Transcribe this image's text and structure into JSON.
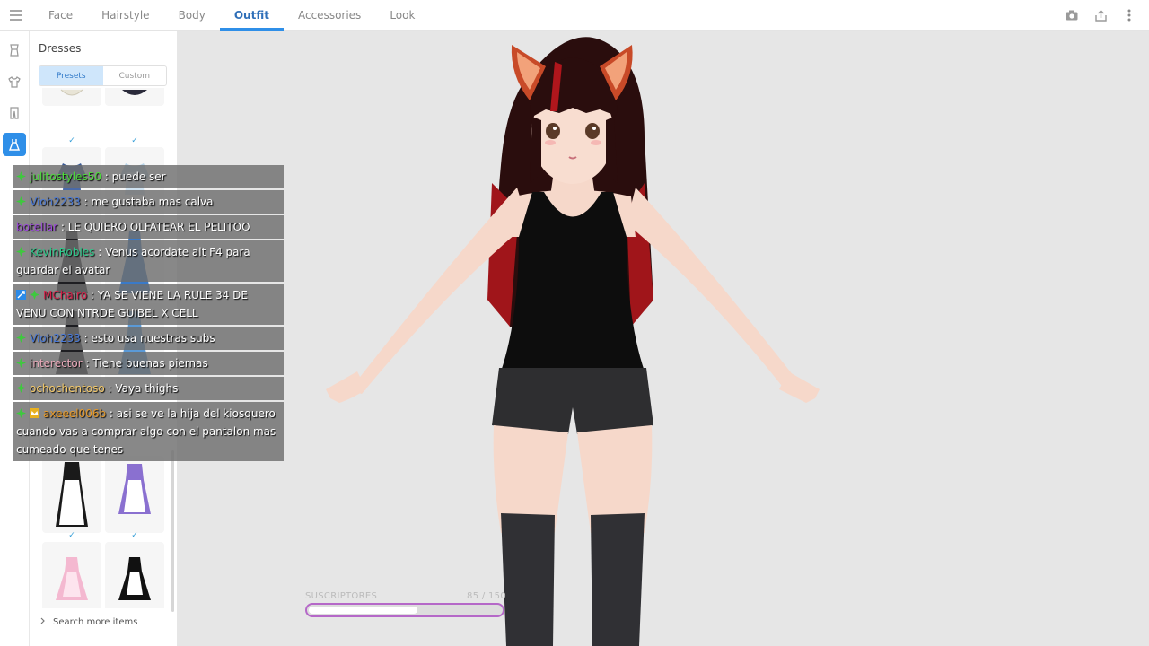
{
  "topbar": {
    "tabs": [
      {
        "label": "Face"
      },
      {
        "label": "Hairstyle"
      },
      {
        "label": "Body"
      },
      {
        "label": "Outfit"
      },
      {
        "label": "Accessories"
      },
      {
        "label": "Look"
      }
    ],
    "active_tab": "Outfit",
    "icons": [
      "menu-icon",
      "camera-icon",
      "share-icon",
      "more-vertical-icon"
    ]
  },
  "rail": {
    "icons": [
      "hanger-icon",
      "shirt-icon",
      "pants-icon",
      "dress-icon"
    ],
    "active": "dress-icon"
  },
  "panel": {
    "title": "Dresses",
    "segments": [
      "Presets",
      "Custom"
    ],
    "active_segment": "Presets",
    "search_more": "Search more items"
  },
  "chat": [
    {
      "badges": [
        "prime-icon"
      ],
      "user": "julitostyles50",
      "user_color": "#4cdc3a",
      "text": " : puede ser"
    },
    {
      "badges": [
        "prime-icon"
      ],
      "user": "Vioh2233",
      "user_color": "#4a7ad8",
      "text": " : me gustaba mas calva"
    },
    {
      "badges": [],
      "user": "botellar",
      "user_color": "#9c4ad8",
      "text": " : LE QUIERO OLFATEAR EL PELITOO"
    },
    {
      "badges": [
        "prime-icon"
      ],
      "user": "KevinRobles",
      "user_color": "#2ec88a",
      "text": " : Venus acordate alt F4 para guardar el avatar"
    },
    {
      "badges": [
        "mod-icon",
        "prime-icon"
      ],
      "user": "MChairo",
      "user_color": "#d8204a",
      "text": " : YA SE VIENE LA RULE 34 DE VENU CON NTRDE GUIBEL X CELL"
    },
    {
      "badges": [
        "prime-icon"
      ],
      "user": "Vioh2233",
      "user_color": "#4a7ad8",
      "text": " : esto usa nuestras subs"
    },
    {
      "badges": [
        "prime-icon"
      ],
      "user": "interector",
      "user_color": "#e8a8b8",
      "text": " : Tiene buenas piernas"
    },
    {
      "badges": [
        "prime-icon"
      ],
      "user": "ochochentoso",
      "user_color": "#f2c86a",
      "text": " : Vaya thighs"
    },
    {
      "badges": [
        "prime-icon",
        "crown-icon"
      ],
      "user": "axeeel006b",
      "user_color": "#e89a28",
      "text": " : asi se ve la hija del kiosquero cuando vas a comprar algo con el pantalon mas cumeado que tenes"
    }
  ],
  "subs": {
    "label": "SUSCRIPTORES",
    "count": "85 / 150",
    "fraction": 0.567
  },
  "colors": {
    "accent": "#2f8fe8",
    "sub_bar_border": "#b568c8"
  }
}
